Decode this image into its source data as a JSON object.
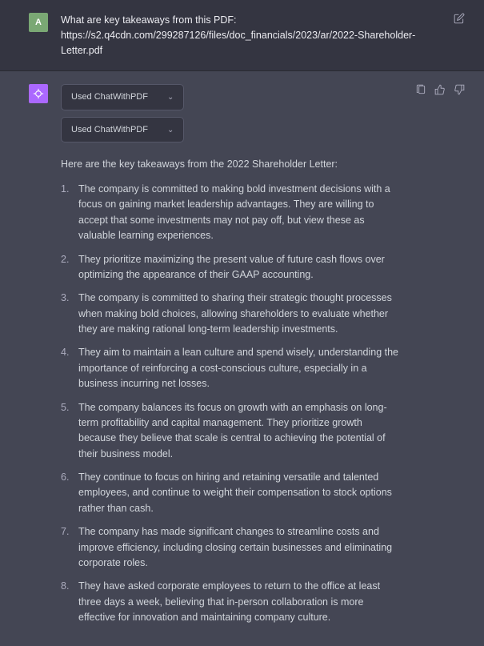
{
  "user": {
    "avatar_letter": "A",
    "message_line1": "What are key takeaways from this PDF:",
    "message_line2": "https://s2.q4cdn.com/299287126/files/doc_financials/2023/ar/2022-Shareholder-Letter.pdf"
  },
  "assistant": {
    "plugin_pill_1": "Used ChatWithPDF",
    "plugin_pill_2": "Used ChatWithPDF",
    "intro": "Here are the key takeaways from the 2022 Shareholder Letter:",
    "items": [
      "The company is committed to making bold investment decisions with a focus on gaining market leadership advantages. They are willing to accept that some investments may not pay off, but view these as valuable learning experiences.",
      "They prioritize maximizing the present value of future cash flows over optimizing the appearance of their GAAP accounting.",
      "The company is committed to sharing their strategic thought processes when making bold choices, allowing shareholders to evaluate whether they are making rational long-term leadership investments.",
      "They aim to maintain a lean culture and spend wisely, understanding the importance of reinforcing a cost-conscious culture, especially in a business incurring net losses.",
      "The company balances its focus on growth with an emphasis on long-term profitability and capital management. They prioritize growth because they believe that scale is central to achieving the potential of their business model.",
      "They continue to focus on hiring and retaining versatile and talented employees, and continue to weight their compensation to stock options rather than cash.",
      "The company has made significant changes to streamline costs and improve efficiency, including closing certain businesses and eliminating corporate roles.",
      "They have asked corporate employees to return to the office at least three days a week, believing that in-person collaboration is more effective for innovation and maintaining company culture."
    ]
  }
}
